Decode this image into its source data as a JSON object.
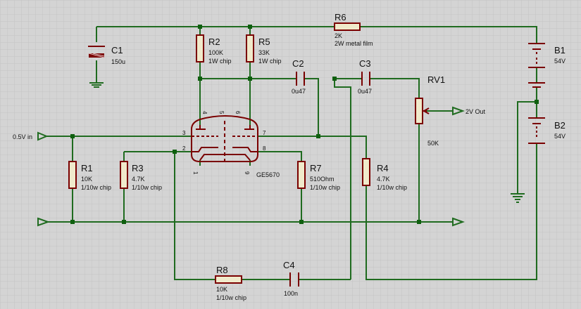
{
  "colors": {
    "background": "#d4d4d4",
    "grid": "#c3c3c3",
    "wire": "#1f6b1f",
    "component": "#7a0000"
  },
  "labels": {
    "r6": {
      "ref": "R6",
      "value": "2K",
      "note": "2W metal film"
    },
    "r2": {
      "ref": "R2",
      "value": "100K",
      "note": "1W chip"
    },
    "r5": {
      "ref": "R5",
      "value": "33K",
      "note": "1W chip"
    },
    "c1": {
      "ref": "C1",
      "value": "150u"
    },
    "c2": {
      "ref": "C2",
      "value": "0u47"
    },
    "c3": {
      "ref": "C3",
      "value": "0u47"
    },
    "rv1": {
      "ref": "RV1",
      "value": "50K"
    },
    "b1": {
      "ref": "B1",
      "value": "54V"
    },
    "b2": {
      "ref": "B2",
      "value": "54V"
    },
    "r1": {
      "ref": "R1",
      "value": "10K",
      "note": "1/10w chip"
    },
    "r3": {
      "ref": "R3",
      "value": "4.7K",
      "note": "1/10w chip"
    },
    "r7": {
      "ref": "R7",
      "value": "510Ohm",
      "note": "1/10w chip"
    },
    "r4": {
      "ref": "R4",
      "value": "4.7K",
      "note": "1/10w chip"
    },
    "r8": {
      "ref": "R8",
      "value": "10K",
      "note": "1/10w chip"
    },
    "c4": {
      "ref": "C4",
      "value": "100n"
    },
    "tube": {
      "ref": "GE5670",
      "pins": [
        "4",
        "5",
        "6",
        "3",
        "7",
        "2",
        "8",
        "1",
        "9"
      ]
    },
    "input_port": "0.5V in",
    "output_port": "2V Out"
  }
}
